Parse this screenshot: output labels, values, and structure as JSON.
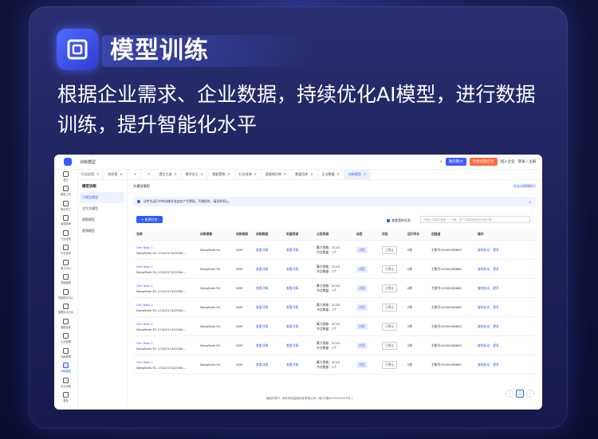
{
  "headline": "模型训练",
  "subtitle": "根据企业需求、企业数据，持续优化AI模型，进行数据训练，提升智能化水平",
  "app": {
    "window_title": "训练模型",
    "topbar_buttons": [
      "我的算力",
      "免费创建企业",
      "加入企业",
      "登录 / 注册"
    ],
    "sidebar": [
      "首页",
      "模型工具",
      "数字员工",
      "智能营销",
      "行业应用",
      "行业咨询",
      "数力中心",
      "智能客服",
      "智能助手中心",
      "数据标注平台",
      "数据仓库",
      "企业数据",
      "训练数据",
      "训练模型",
      "企业设置",
      "更多"
    ],
    "tabs": [
      "行业应用",
      "实验室",
      "",
      "",
      "提交工具",
      "数字员工",
      "智能营销",
      "行业咨询",
      "智能知识库",
      "数据仓库",
      "企业数据",
      "训练模型"
    ],
    "subnav_title": "模型训练",
    "subnav": [
      "大模型模型",
      "文生文模型",
      "视图模型",
      "视频模型"
    ],
    "breadcrumb": "大模型模型",
    "breadcrumb_right": "任务式建模推行",
    "notice": "试传为运行中的训练任务会在产生费用，不使用时，请及时停止。",
    "new_button": "+ 新建任务",
    "checkbox_label": "查看我的任务",
    "search_placeholder": "请输入关键字搜索 \"/\" 分隔，多个关键词使用回车键分隔",
    "columns": [
      "名称",
      "训练镜像",
      "训练框架",
      "训练数据",
      "机器资源",
      "占用资源",
      "标签",
      "状态",
      "运行时长",
      "创建者",
      "操作"
    ],
    "rows": [
      {
        "name1": "Umi New 1",
        "name2": "DeepSeek R1-1742217422264...",
        "image": "DeepSeek R1",
        "frame": "DDP",
        "data": "查看详情",
        "machine": "查看详情",
        "res1": "算力规格：2C2G",
        "res2": "节点数量：1个",
        "tag": "对话",
        "status": "已停止",
        "time": "0秒",
        "creator": "主账号10000458865",
        "op1": "复制启动",
        "op2": "更多"
      },
      {
        "name1": "Umi New 1",
        "name2": "DeepSeek R1-1742217422264...",
        "image": "DeepSeek R1",
        "frame": "DDP",
        "data": "查看详情",
        "machine": "查看详情",
        "res1": "算力规格：2C2G",
        "res2": "节点数量：1个",
        "tag": "对话",
        "status": "已停止",
        "time": "0秒",
        "creator": "主账号10000458865",
        "op1": "复制启动",
        "op2": "更多"
      },
      {
        "name1": "Umi New 1",
        "name2": "DeepSeek R1-1742217422264...",
        "image": "DeepSeek R1",
        "frame": "DDP",
        "data": "查看详情",
        "machine": "查看详情",
        "res1": "算力规格：2C2G",
        "res2": "节点数量：1个",
        "tag": "对话",
        "status": "已停止",
        "time": "0秒",
        "creator": "主账号10000458865",
        "op1": "复制启动",
        "op2": "更多"
      },
      {
        "name1": "Umi New 1",
        "name2": "DeepSeek R1-1742217422264...",
        "image": "DeepSeek R1",
        "frame": "DDP",
        "data": "查看详情",
        "machine": "查看详情",
        "res1": "算力规格：2C2G",
        "res2": "节点数量：1个",
        "tag": "对话",
        "status": "已停止",
        "time": "0秒",
        "creator": "主账号10000458865",
        "op1": "复制启动",
        "op2": "更多"
      },
      {
        "name1": "Umi New 1",
        "name2": "DeepSeek R1-1742217422264...",
        "image": "DeepSeek R1",
        "frame": "DDP",
        "data": "查看详情",
        "machine": "查看详情",
        "res1": "算力规格：2C2G",
        "res2": "节点数量：1个",
        "tag": "对话",
        "status": "已停止",
        "time": "0秒",
        "creator": "主账号10000458865",
        "op1": "复制启动",
        "op2": "更多"
      },
      {
        "name1": "Umi New 1",
        "name2": "DeepSeek R1-1742217422264...",
        "image": "DeepSeek R1",
        "frame": "DDP",
        "data": "查看详情",
        "machine": "查看详情",
        "res1": "算力规格：2C2G",
        "res2": "节点数量：1个",
        "tag": "对话",
        "status": "已停止",
        "time": "0秒",
        "creator": "主账号10000458865",
        "op1": "复制启动",
        "op2": "更多"
      },
      {
        "name1": "Umi New 1",
        "name2": "DeepSeek R1-1742217422264...",
        "image": "DeepSeek R1",
        "frame": "DDP",
        "data": "查看详情",
        "machine": "查看详情",
        "res1": "算力规格：2C2G",
        "res2": "节点数量：1个",
        "tag": "对话",
        "status": "已停止",
        "time": "0秒",
        "creator": "主账号10000458865",
        "op1": "复制启动",
        "op2": "更多"
      }
    ],
    "page": "1",
    "footer": "版权所有© 深圳市优智能科技有限公司 | 粤ICP备2023054291号-1"
  },
  "colors": {
    "accent": "#2f5cff",
    "background": "#1d2058"
  }
}
